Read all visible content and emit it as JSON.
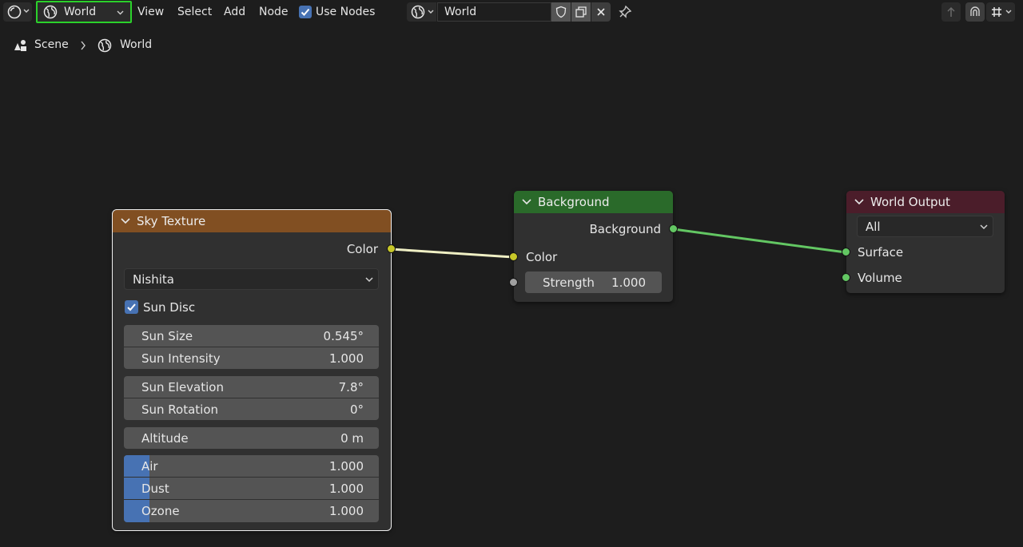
{
  "header": {
    "shader_type": "World",
    "menus": [
      "View",
      "Select",
      "Add",
      "Node"
    ],
    "use_nodes_label": "Use Nodes",
    "use_nodes_checked": true,
    "world_name": "World"
  },
  "breadcrumb": {
    "scene": "Scene",
    "world": "World"
  },
  "nodes": {
    "sky_texture": {
      "title": "Sky Texture",
      "output_color": "Color",
      "type_value": "Nishita",
      "sun_disc_label": "Sun Disc",
      "sun_disc_checked": true,
      "sun_size": {
        "label": "Sun Size",
        "value": "0.545°"
      },
      "sun_intensity": {
        "label": "Sun Intensity",
        "value": "1.000"
      },
      "sun_elevation": {
        "label": "Sun Elevation",
        "value": "7.8°"
      },
      "sun_rotation": {
        "label": "Sun Rotation",
        "value": "0°"
      },
      "altitude": {
        "label": "Altitude",
        "value": "0 m"
      },
      "air": {
        "label": "Air",
        "value": "1.000",
        "fraction": 0.1
      },
      "dust": {
        "label": "Dust",
        "value": "1.000",
        "fraction": 0.1
      },
      "ozone": {
        "label": "Ozone",
        "value": "1.000",
        "fraction": 0.1
      }
    },
    "background": {
      "title": "Background",
      "output_background": "Background",
      "input_color": "Color",
      "strength": {
        "label": "Strength",
        "value": "1.000"
      }
    },
    "world_output": {
      "title": "World Output",
      "target_value": "All",
      "input_surface": "Surface",
      "input_volume": "Volume"
    }
  },
  "colors": {
    "sky_header": "#814f22",
    "background_header": "#2a6a2a",
    "world_output_header": "#4b1d2a",
    "color_socket": "#c7c729",
    "shader_socket": "#63c763",
    "float_socket": "#a1a1a1",
    "color_link": "#efefc4",
    "shader_link": "#63c763",
    "accent": "#4772b3",
    "highlight": "#2bd12b"
  }
}
